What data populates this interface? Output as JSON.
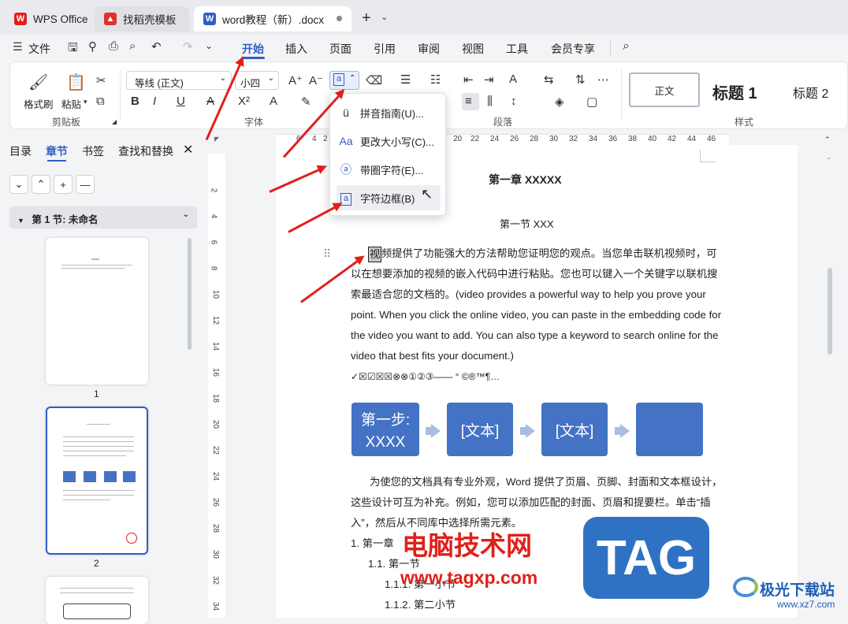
{
  "tabs": [
    {
      "label": "WPS Office"
    },
    {
      "label": "找稻壳模板"
    },
    {
      "label": "word教程（新）.docx"
    }
  ],
  "menu": {
    "file": "文件",
    "items": [
      "开始",
      "插入",
      "页面",
      "引用",
      "审阅",
      "视图",
      "工具",
      "会员专享"
    ],
    "active": "开始"
  },
  "ribbon": {
    "clipboard": {
      "format_painter": "格式刷",
      "paste": "粘贴",
      "group": "剪贴板"
    },
    "font": {
      "name": "等线 (正文)",
      "size": "小四",
      "group": "字体"
    },
    "paragraph": {
      "group": "段落"
    },
    "styles": {
      "group": "样式",
      "normal": "正文",
      "h1": "标题 1",
      "h2": "标题 2"
    }
  },
  "dropdown": [
    {
      "label": "拼音指南(U)...",
      "icon": "pinyin-icon"
    },
    {
      "label": "更改大小写(C)...",
      "icon": "change-case-icon"
    },
    {
      "label": "带圈字符(E)...",
      "icon": "enclosed-char-icon"
    },
    {
      "label": "字符边框(B)",
      "icon": "char-border-icon"
    }
  ],
  "nav": {
    "tabs": [
      "目录",
      "章节",
      "书签",
      "查找和替换"
    ],
    "active": "章节",
    "section": "第 1 节: 未命名",
    "pages": [
      "1",
      "2"
    ]
  },
  "ruler_top": [
    "6",
    "4",
    "2",
    "",
    "20",
    "22",
    "24",
    "26",
    "28",
    "30",
    "32",
    "34",
    "36",
    "38",
    "40",
    "42",
    "44",
    "46"
  ],
  "ruler_left": [
    "2",
    "4",
    "6",
    "8",
    "10",
    "12",
    "14",
    "16",
    "18",
    "20",
    "22",
    "24",
    "26",
    "28",
    "30",
    "32",
    "34"
  ],
  "document": {
    "chapter": "第一章  XXXXX",
    "section": "第一节 XXX",
    "bordered_char": "视",
    "p1_line1": "频提供了功能强大的方法帮助您证明您的观点。当您单击联机视频时，可",
    "p1_line2": "以在想要添加的视频的嵌入代码中进行粘贴。您也可以键入一个关键字以联机搜",
    "p1_line3": "索最适合您的文档的。(video provides a powerful way to help you prove your",
    "p1_line4": "point. When you click the online video, you can paste in the embedding code for",
    "p1_line5": "the video you want to add. You can also type a keyword to search online for the",
    "p1_line6": "video that best fits your document.)",
    "symbols": "✓☒☑☒☒⊗⊗①②③——  °  ©®™¶…",
    "flow": [
      {
        "l1": "第一步:",
        "l2": "XXXX"
      },
      {
        "l1": "[文本]",
        "l2": ""
      },
      {
        "l1": "[文本]",
        "l2": ""
      },
      {
        "l1": "",
        "l2": ""
      }
    ],
    "p2_line1": "为使您的文档具有专业外观，Word 提供了页眉、页脚、封面和文本框设计，",
    "p2_line2": "这些设计可互为补充。例如，您可以添加匹配的封面、页眉和提要栏。单击“插",
    "p2_line3": "入”，然后从不同库中选择所需元素。",
    "list1": "1.    第一章",
    "list2": "1.1.  第一节",
    "list3": "1.1.1.  第一小节",
    "list4": "1.1.2.  第二小节"
  },
  "watermarks": {
    "site_cn": "电脑技术网",
    "site_url": "www.tagxp.com",
    "tag": "TAG",
    "brand": "极光下载站",
    "brand_url": "www.xz7.com"
  },
  "colors": {
    "accent": "#2f5ec7",
    "flow": "#4472c4",
    "arrow": "#e0201b"
  }
}
